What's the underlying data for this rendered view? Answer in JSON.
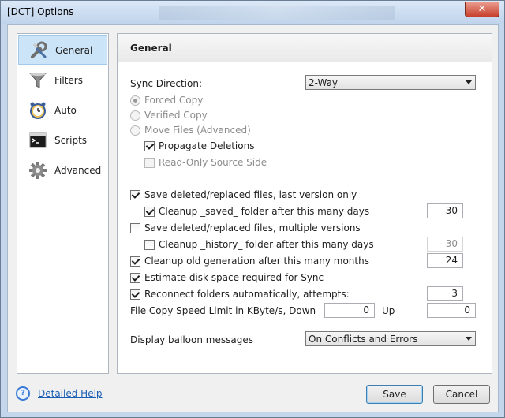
{
  "window": {
    "title": "[DCT] Options",
    "close_glyph": "✕"
  },
  "nav": {
    "items": [
      {
        "label": "General",
        "icon": "wrench-screwdriver-icon",
        "active": true
      },
      {
        "label": "Filters",
        "icon": "funnel-icon"
      },
      {
        "label": "Auto",
        "icon": "alarm-clock-icon"
      },
      {
        "label": "Scripts",
        "icon": "terminal-icon"
      },
      {
        "label": "Advanced",
        "icon": "gear-icon"
      }
    ]
  },
  "panel": {
    "header": "General",
    "sync_direction": {
      "label": "Sync Direction:",
      "value": "2-Way"
    },
    "radios": {
      "forced_copy": "Forced Copy",
      "verified_copy": "Verified Copy",
      "move_files": "Move Files (Advanced)"
    },
    "propagate_deletions": "Propagate Deletions",
    "read_only_source": "Read-Only Source Side",
    "save_last_version": "Save deleted/replaced files, last version only",
    "cleanup_saved": {
      "label": "Cleanup _saved_ folder after this many days",
      "value": "30"
    },
    "save_multiple": "Save deleted/replaced files, multiple versions",
    "cleanup_history": {
      "label": "Cleanup _history_ folder after this many days",
      "value": "30"
    },
    "cleanup_old_gen": {
      "label": "Cleanup old generation after this many months",
      "value": "24"
    },
    "estimate_disk": "Estimate disk space required for Sync",
    "reconnect": {
      "label": "Reconnect folders automatically, attempts:",
      "value": "3"
    },
    "speed_limit": {
      "label": "File Copy Speed Limit in KByte/s, Down",
      "down": "0",
      "up_label": "Up",
      "up": "0"
    },
    "balloon": {
      "label": "Display balloon messages",
      "value": "On Conflicts and Errors"
    }
  },
  "footer": {
    "help_label": "Detailed Help",
    "help_glyph": "?",
    "save_label": "Save",
    "cancel_label": "Cancel"
  }
}
